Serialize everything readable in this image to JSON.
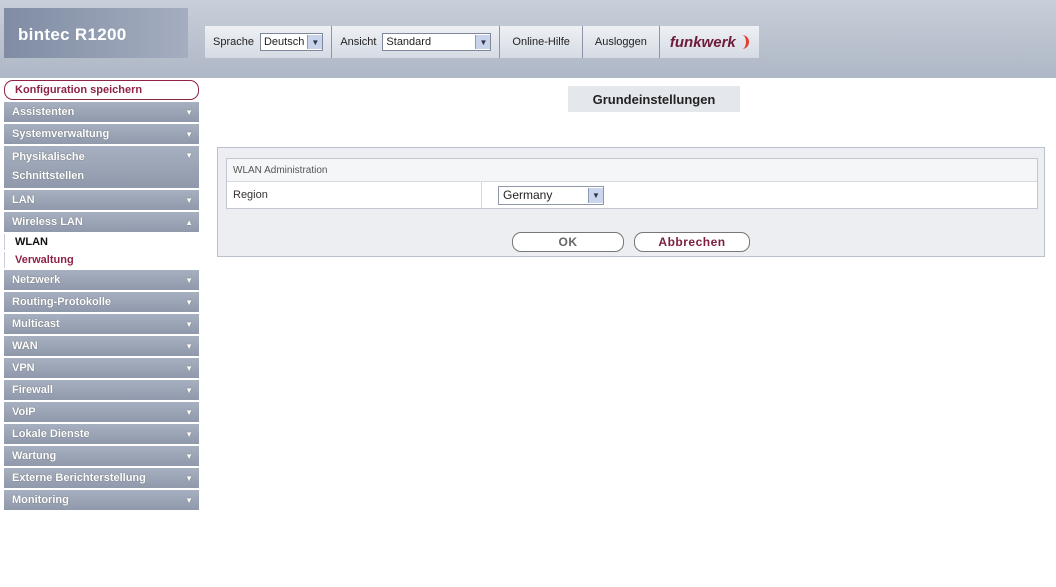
{
  "header": {
    "logo": "bintec R1200",
    "language_label": "Sprache",
    "language_value": "Deutsch",
    "view_label": "Ansicht",
    "view_value": "Standard",
    "online_help": "Online-Hilfe",
    "logout": "Ausloggen",
    "brand": "funkwerk"
  },
  "sidebar": {
    "save": "Konfiguration speichern",
    "items": [
      {
        "label": "Assistenten"
      },
      {
        "label": "Systemverwaltung"
      },
      {
        "label": "Physikalische",
        "label2": "Schnittstellen"
      },
      {
        "label": "LAN"
      },
      {
        "label": "Wireless LAN"
      },
      {
        "label": "Netzwerk"
      },
      {
        "label": "Routing-Protokolle"
      },
      {
        "label": "Multicast"
      },
      {
        "label": "WAN"
      },
      {
        "label": "VPN"
      },
      {
        "label": "Firewall"
      },
      {
        "label": "VoIP"
      },
      {
        "label": "Lokale Dienste"
      },
      {
        "label": "Wartung"
      },
      {
        "label": "Externe Berichterstellung"
      },
      {
        "label": "Monitoring"
      }
    ],
    "sub_items": [
      "WLAN",
      "Verwaltung"
    ]
  },
  "main": {
    "title": "Grundeinstellungen",
    "section": "WLAN Administration",
    "region_label": "Region",
    "region_value": "Germany",
    "ok": "OK",
    "cancel": "Abbrechen"
  },
  "colors": {
    "accent": "#8e2346",
    "nav": "#98a2b4",
    "brand": "#6e1a3b"
  }
}
